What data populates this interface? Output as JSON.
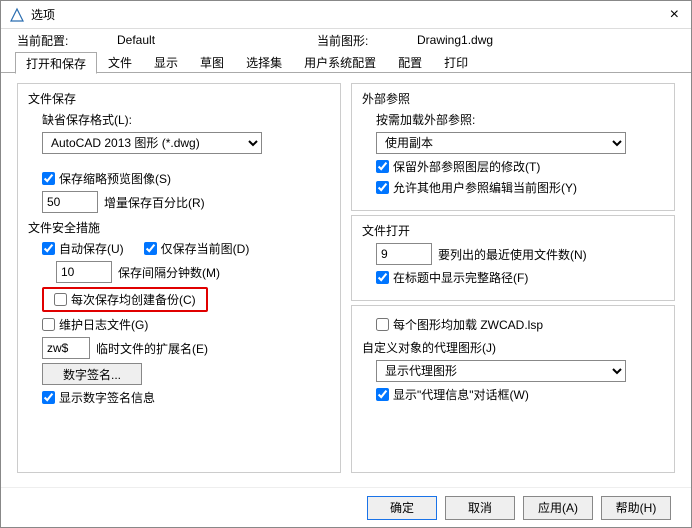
{
  "window": {
    "title": "选项"
  },
  "info": {
    "curConfigLabel": "当前配置:",
    "curConfigValue": "Default",
    "curDrawingLabel": "当前图形:",
    "curDrawingValue": "Drawing1.dwg"
  },
  "tabs": {
    "t0": "打开和保存",
    "t1": "文件",
    "t2": "显示",
    "t3": "草图",
    "t4": "选择集",
    "t5": "用户系统配置",
    "t6": "配置",
    "t7": "打印"
  },
  "left": {
    "fileSave": {
      "title": "文件保存",
      "defaultFormatLabel": "缺省保存格式(L):",
      "defaultFormatValue": "AutoCAD 2013 图形 (*.dwg)",
      "thumbPreview": "保存缩略预览图像(S)",
      "incSaveValue": "50",
      "incSaveLabel": "增量保存百分比(R)"
    },
    "fileSafety": {
      "title": "文件安全措施",
      "autoSave": "自动保存(U)",
      "onlyCurrent": "仅保存当前图(D)",
      "intervalValue": "10",
      "intervalLabel": "保存间隔分钟数(M)",
      "backupEach": "每次保存均创建备份(C)",
      "maintainLog": "维护日志文件(G)",
      "tempExtValue": "zw$",
      "tempExtLabel": "临时文件的扩展名(E)",
      "digitalSig": "数字签名...",
      "showSigInfo": "显示数字签名信息"
    }
  },
  "right": {
    "xref": {
      "title": "外部参照",
      "loadLabel": "按需加载外部参照:",
      "loadValue": "使用副本",
      "keepLayer": "保留外部参照图层的修改(T)",
      "allowEdit": "允许其他用户参照编辑当前图形(Y)"
    },
    "fileOpen": {
      "title": "文件打开",
      "recentValue": "9",
      "recentLabel": "要列出的最近使用文件数(N)",
      "fullPath": "在标题中显示完整路径(F)"
    },
    "misc": {
      "loadLsp": "每个图形均加载 ZWCAD.lsp",
      "proxyTitle": "自定义对象的代理图形(J)",
      "proxyValue": "显示代理图形",
      "showProxyInfo": "显示\"代理信息\"对话框(W)"
    }
  },
  "footer": {
    "ok": "确定",
    "cancel": "取消",
    "apply": "应用(A)",
    "help": "帮助(H)"
  }
}
